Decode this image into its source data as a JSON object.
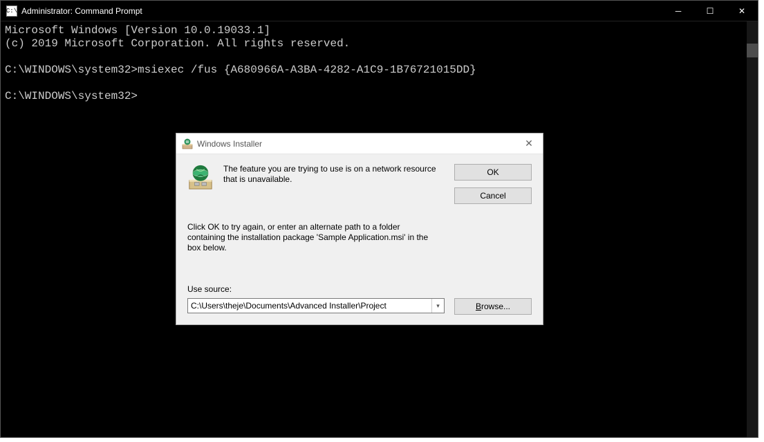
{
  "cmd": {
    "title": "Administrator: Command Prompt",
    "icon_label": "C:\\",
    "lines": {
      "l1": "Microsoft Windows [Version 10.0.19033.1]",
      "l2": "(c) 2019 Microsoft Corporation. All rights reserved.",
      "l3": "",
      "l4": "C:\\WINDOWS\\system32>msiexec /fus {A680966A-A3BA-4282-A1C9-1B76721015DD}",
      "l5": "",
      "l6": "C:\\WINDOWS\\system32>"
    },
    "controls": {
      "minimize": "─",
      "maximize": "☐",
      "close": "✕"
    }
  },
  "dialog": {
    "title": "Windows Installer",
    "close": "✕",
    "message": "The feature you are trying to use is on a network resource that is unavailable.",
    "instructions": "Click OK to try again, or enter an alternate path to a folder containing the installation package 'Sample Application.msi' in the box below.",
    "use_source_label": "Use source:",
    "source_value": "C:\\Users\\theje\\Documents\\Advanced Installer\\Project",
    "buttons": {
      "ok": "OK",
      "cancel": "Cancel",
      "browse": "Browse..."
    }
  }
}
